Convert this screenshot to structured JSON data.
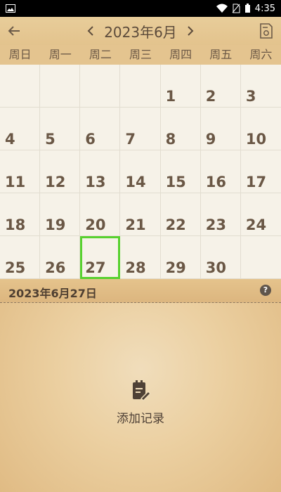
{
  "statusbar": {
    "time": "4:35"
  },
  "header": {
    "title": "2023年6月"
  },
  "weekdays": [
    "周日",
    "周一",
    "周二",
    "周三",
    "周四",
    "周五",
    "周六"
  ],
  "calendar": {
    "weeks": [
      [
        "",
        "",
        "",
        "",
        "1",
        "2",
        "3"
      ],
      [
        "4",
        "5",
        "6",
        "7",
        "8",
        "9",
        "10"
      ],
      [
        "11",
        "12",
        "13",
        "14",
        "15",
        "16",
        "17"
      ],
      [
        "18",
        "19",
        "20",
        "21",
        "22",
        "23",
        "24"
      ],
      [
        "25",
        "26",
        "27",
        "28",
        "29",
        "30",
        ""
      ]
    ]
  },
  "selected": {
    "date": "2023年6月27日"
  },
  "actions": {
    "add_record": "添加记录"
  },
  "colors": {
    "selected_border": "#57d12e",
    "text": "#6a5745"
  },
  "icons": [
    "back-arrow-icon",
    "chevron-left-icon",
    "chevron-right-icon",
    "document-settings-icon",
    "help-icon",
    "add-note-icon"
  ]
}
